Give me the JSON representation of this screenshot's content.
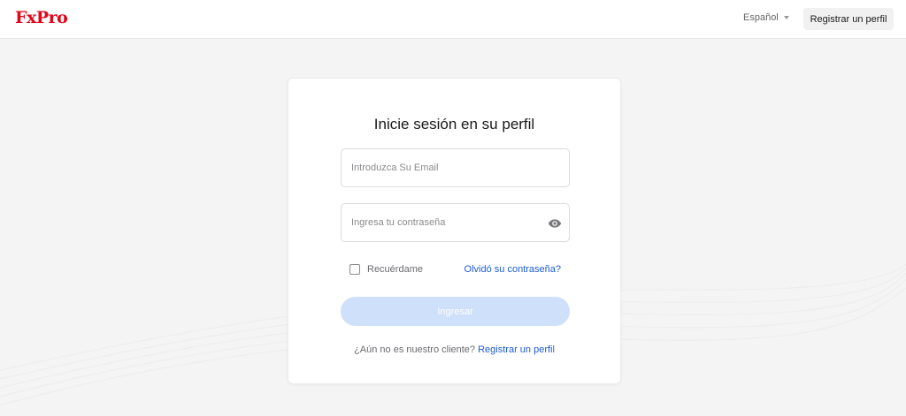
{
  "header": {
    "logo": "FxPro",
    "language": "Español",
    "register_label": "Registrar un perfil"
  },
  "card": {
    "title": "Inicie sesión en su perfil",
    "email": {
      "placeholder": "Introduzca Su Email",
      "value": ""
    },
    "password": {
      "placeholder": "Ingresa tu contraseña",
      "value": "",
      "toggle_icon": "eye-icon"
    },
    "remember_label": "Recuérdame",
    "remember_checked": false,
    "forgot_label": "Olvidó su contraseña?",
    "submit_label": "Ingresar",
    "not_client_text": "¿Aún no es nuestro cliente?",
    "register_link": "Registrar un perfil"
  },
  "colors": {
    "brand": "#e3051b",
    "link": "#1d5bd6",
    "submit_disabled": "#cfe0fb",
    "background": "#f4f4f5"
  }
}
